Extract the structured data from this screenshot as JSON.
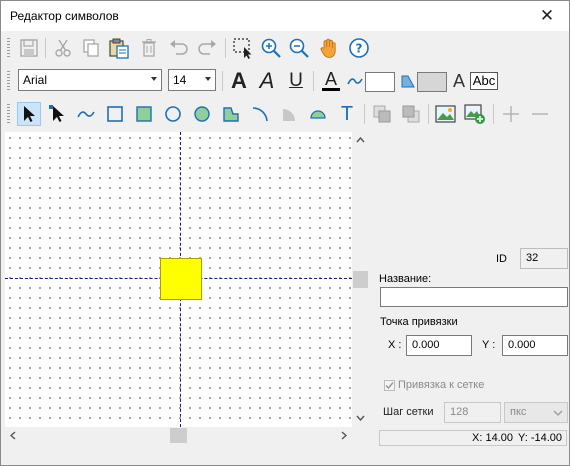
{
  "window": {
    "title": "Редактор символов",
    "close_glyph": "✕"
  },
  "toolbar1": {
    "icons": [
      "save-icon",
      "cut-icon",
      "copy-icon",
      "paste-icon",
      "delete-icon",
      "undo-icon",
      "redo-icon",
      "select-area-icon",
      "zoom-in-icon",
      "zoom-out-icon",
      "pan-hand-icon",
      "help-icon"
    ]
  },
  "toolbar2": {
    "font_family": "Arial",
    "font_size": "14",
    "bold_glyph": "A",
    "italic_glyph": "A",
    "underline_glyph": "U",
    "font_color_glyph": "A",
    "text_glyph": "A",
    "textbox_glyph": "Abc",
    "font_color": "#000000",
    "accent": "#1e6fb8"
  },
  "toolbar3": {
    "text_tool_glyph": "T",
    "icons": [
      "pointer-icon",
      "node-select-icon",
      "polyline-icon",
      "rectangle-icon",
      "filled-rectangle-icon",
      "ellipse-icon",
      "filled-ellipse-icon",
      "polygon-icon",
      "arc-icon",
      "pie-icon",
      "chord-icon",
      "text-tool-icon",
      "bring-front-icon",
      "send-back-icon",
      "insert-image-icon",
      "add-image-icon",
      "add-point-icon",
      "remove-point-icon"
    ]
  },
  "canvas": {
    "symbol_color": "#ffff00",
    "axis_color": "#1a1a8a"
  },
  "properties": {
    "id_label": "ID",
    "id_value": "32",
    "name_label": "Название:",
    "name_value": "",
    "anchor_label": "Точка привязки",
    "x_label": "X :",
    "x_value": "0.000",
    "y_label": "Y :",
    "y_value": "0.000",
    "snap_label": "Привязка к сетке",
    "snap_checked": true,
    "grid_step_label": "Шаг сетки",
    "grid_step_value": "128",
    "grid_unit": "пкс"
  },
  "status": {
    "x_text": "X: 14.00",
    "y_text": "Y: -14.00"
  }
}
